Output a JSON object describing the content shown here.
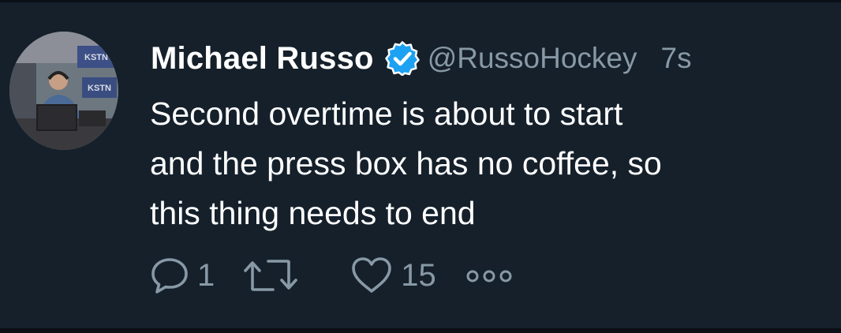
{
  "tweet": {
    "display_name": "Michael Russo",
    "handle": "@RussoHockey",
    "time": "7s",
    "text": "Second overtime is about to start\nand the press box has no coffee, so\nthis thing needs to end",
    "verified": true
  },
  "actions": {
    "reply_count": "1",
    "retweet_count": "",
    "like_count": "15"
  },
  "avatar_sign_text": "KSTN",
  "icons": {
    "avatar": "avatar-photo",
    "verified": "verified-badge-icon",
    "reply": "reply-icon",
    "retweet": "retweet-icon",
    "like": "heart-icon",
    "more": "more-icon"
  },
  "colors": {
    "background": "#15202b",
    "text_primary": "#ffffff",
    "text_secondary": "#8899a6",
    "verified_blue": "#1da1f2"
  }
}
